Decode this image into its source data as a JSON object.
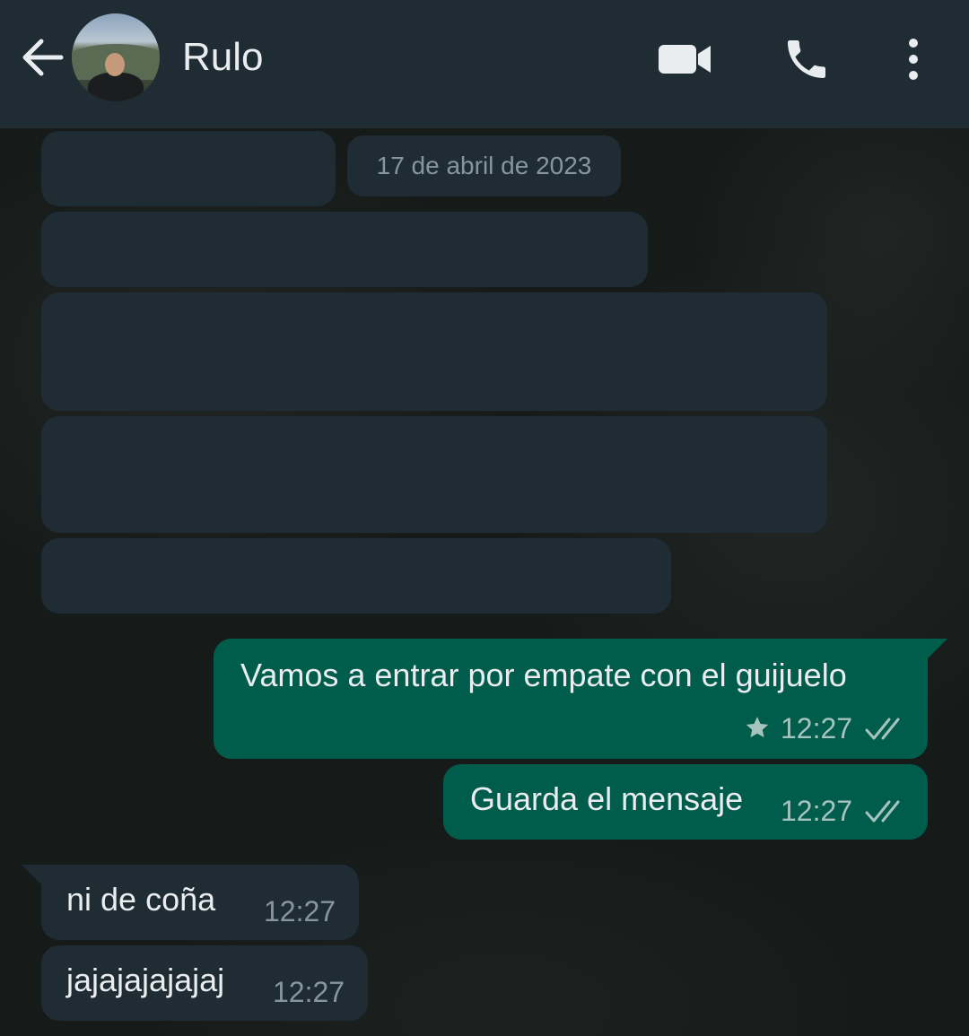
{
  "header": {
    "contact_name": "Rulo",
    "icons": [
      "back-arrow-icon",
      "video-call-icon",
      "phone-icon",
      "more-options-icon"
    ]
  },
  "chat": {
    "date_chip": "17 de abril de 2023",
    "messages": [
      {
        "direction": "outgoing",
        "text": "Vamos a entrar por empate con el guijuelo",
        "time": "12:27",
        "starred": true,
        "status": "read"
      },
      {
        "direction": "outgoing",
        "text": "Guarda el mensaje",
        "time": "12:27",
        "starred": false,
        "status": "read"
      },
      {
        "direction": "incoming",
        "text": "ni de coña",
        "time": "12:27"
      },
      {
        "direction": "incoming",
        "text": "jajajajajajaj",
        "time": "12:27"
      }
    ]
  },
  "colors": {
    "header_bg": "#1f2c33",
    "incoming_bubble": "#1f2c33",
    "outgoing_bubble": "#005c4b",
    "text": "#e9edef",
    "meta_text": "#8696a0"
  }
}
